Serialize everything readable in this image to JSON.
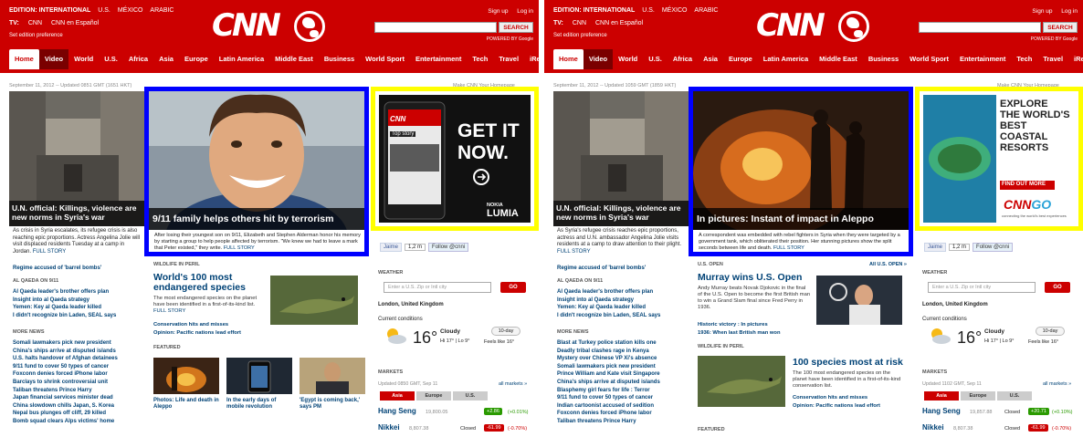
{
  "panels": [
    {
      "header": {
        "edition_label": "EDITION: INTERNATIONAL",
        "edition_links": [
          "U.S.",
          "MÉXICO",
          "ARABIC"
        ],
        "tv_label": "TV:",
        "tv_links": [
          "CNN",
          "CNN en Español"
        ],
        "set_pref": "Set edition preference",
        "logo": "CNN",
        "sign_up": "Sign up",
        "log_in": "Log in",
        "search_button": "SEARCH",
        "powered_by": "POWERED BY Google"
      },
      "nav": [
        "Home",
        "Video",
        "World",
        "U.S.",
        "Africa",
        "Asia",
        "Europe",
        "Latin America",
        "Middle East",
        "Business",
        "World Sport",
        "Entertainment",
        "Tech",
        "Travel",
        "iReport"
      ],
      "date_line": "September 11, 2012 -- Updated 0851 GMT (1651 HKT)",
      "make_cnn": "Make CNN Your Homepage",
      "lead": {
        "caption": "U.N. official: Killings, violence are new norms in Syria's war",
        "summary": "As crisis in Syria escalates, its refugee crisis is also reaching epic proportions. Actress Angelina Jolie will visit displaced residents Tuesday at a camp in Jordan.",
        "full_story": "FULL STORY"
      },
      "lead_bullets": [
        "Regime accused of 'barrel bombs'"
      ],
      "section1": "AL QAEDA ON 9/11",
      "section1_items": [
        "Al Qaeda leader's brother offers plan",
        "Insight into al Qaeda strategy",
        "Yemen: Key al Qaeda leader killed",
        "I didn't recognize bin Laden, SEAL says"
      ],
      "section2": "MORE NEWS",
      "section2_items": [
        "Somali lawmakers pick new president",
        "China's ships arrive at disputed islands",
        "U.S. halts handover of Afghan detainees",
        "9/11 fund to cover 50 types of cancer",
        "Foxconn denies forced iPhone labor",
        "Barclays to shrink controversial unit",
        "Taliban threatens Prince Harry",
        "Japan financial services minister dead",
        "China slowdown chills Japan, S. Korea",
        "Nepal bus plunges off cliff, 29 killed",
        "Bomb squad clears Alps victims' home"
      ],
      "feature": {
        "caption": "9/11 family helps others hit by terrorism",
        "summary": "After losing their youngest son on 9/11, Elizabeth and Stephen Alderman honor his memory by starting a group to help people affected by terrorism. \"We knew we had to leave a mark that Peter existed,\" they write.",
        "full_story": "FULL STORY"
      },
      "ad": {
        "headline1": "GET IT",
        "headline2": "NOW.",
        "brand1": "NOKIA",
        "brand2": "LUMIA",
        "phone_header": "CNN",
        "phone_story": "Top story"
      },
      "social": {
        "facebook": "Jaime",
        "count": "1,2 m",
        "twitter": "Follow @cnni"
      },
      "mid": {
        "section": "WILDLIFE IN PERIL",
        "headline": "World's 100 most endangered species",
        "summary": "The most endangered species on the planet have been identified in a first-of-its-kind list.",
        "full_story": "FULL STORY",
        "bullets": [
          "Conservation hits and misses",
          "Opinion: Pacific nations lead effort"
        ],
        "featured_label": "FEATURED",
        "featured": [
          "Photos: Life and death in Aleppo",
          "In the early days of mobile revolution",
          "'Egypt is coming back,' says PM"
        ]
      },
      "weather": {
        "section": "WEATHER",
        "placeholder": "Enter a U.S. Zip or Intl city",
        "go": "GO",
        "location": "London, United Kingdom",
        "current_label": "Current conditions",
        "temp": "16°",
        "condition": "Cloudy",
        "hilo": "Hi 17° | Lo 9°",
        "ten_day": "10-day",
        "feels": "Feels like 16°"
      },
      "markets": {
        "section": "MARKETS",
        "updated": "Updated 0850 GMT, Sep 11",
        "all_markets": "all markets »",
        "tabs": [
          "Asia",
          "Europe",
          "U.S."
        ],
        "rows": [
          {
            "name": "Hang Seng",
            "value": "19,800.05",
            "status": "",
            "change": "+2.86",
            "pct": "(+0.01%)",
            "up": true
          },
          {
            "name": "Nikkei",
            "value": "8,807.38",
            "status": "Closed",
            "change": "-61.99",
            "pct": "(-0.70%)",
            "up": false
          }
        ]
      }
    },
    {
      "header": {
        "edition_label": "EDITION: INTERNATIONAL",
        "edition_links": [
          "U.S.",
          "MÉXICO",
          "ARABIC"
        ],
        "tv_label": "TV:",
        "tv_links": [
          "CNN",
          "CNN en Español"
        ],
        "set_pref": "Set edition preference",
        "logo": "CNN",
        "sign_up": "Sign up",
        "log_in": "Log in",
        "search_button": "SEARCH",
        "powered_by": "POWERED BY Google"
      },
      "nav": [
        "Home",
        "Video",
        "World",
        "U.S.",
        "Africa",
        "Asia",
        "Europe",
        "Latin America",
        "Middle East",
        "Business",
        "World Sport",
        "Entertainment",
        "Tech",
        "Travel",
        "iReport"
      ],
      "date_line": "September 11, 2012 -- Updated 1059 GMT (1859 HKT)",
      "make_cnn": "Make CNN Your Homepage",
      "lead": {
        "caption": "U.N. official: Killings, violence are new norms in Syria's war",
        "summary": "As Syria's refugee crisis reaches epic proportions, actress and U.N. ambassador Angelina Jolie visits residents at a camp to draw attention to their plight.",
        "full_story": "FULL STORY"
      },
      "lead_bullets": [
        "Regime accused of 'barrel bombs'"
      ],
      "section1": "AL QAEDA ON 9/11",
      "section1_items": [
        "Al Qaeda leader's brother offers plan",
        "Insight into al Qaeda strategy",
        "Yemen: Key al Qaeda leader killed",
        "I didn't recognize bin Laden, SEAL says"
      ],
      "section2": "MORE NEWS",
      "section2_items": [
        "Blast at Turkey police station kills one",
        "Deadly tribal clashes rage in Kenya",
        "Mystery over Chinese VP Xi's absence",
        "Somali lawmakers pick new president",
        "Prince William and Kate visit Singapore",
        "China's ships arrive at disputed islands",
        "Blasphemy girl fears for life : Terror",
        "9/11 fund to cover 50 types of cancer",
        "Indian cartoonist accused of sedition",
        "Foxconn denies forced iPhone labor",
        "Taliban threatens Prince Harry"
      ],
      "feature": {
        "caption": "In pictures: Instant of impact in Aleppo",
        "summary": "A correspondent was embedded with rebel fighters in Syria when they were targeted by a government tank, which obliterated their position. Her stunning pictures show the split seconds between life and death.",
        "full_story": "FULL STORY"
      },
      "ad": {
        "headline1": "EXPLORE",
        "headline2": "THE WORLD'S BEST COASTAL RESORTS",
        "find_out": "FIND OUT MORE",
        "brand1": "CNN",
        "brand2": "GO",
        "tagline": "connecting the world's best experiences"
      },
      "social": {
        "facebook": "Jaime",
        "count": "1,2 m",
        "twitter": "Follow @cnni"
      },
      "mid": {
        "section": "U.S. OPEN",
        "section_link": "All U.S. OPEN »",
        "headline": "Murray wins U.S. Open",
        "summary": "Andy Murray beats Novak Djokovic in the final of the U.S. Open to become the first British man to win a Grand Slam final since Fred Perry in 1936.",
        "full_story": "FULL STORY",
        "bullets": [
          "Historic victory : In pictures",
          "1936: When last British man won"
        ],
        "section2": "WILDLIFE IN PERIL",
        "headline2": "100 species most at risk",
        "summary2": "The 100 most endangered species on the planet have been identified in a first-of-its-kind conservation list.",
        "bullets2": [
          "Conservation hits and misses",
          "Opinion: Pacific nations lead effort"
        ],
        "featured_label": "FEATURED"
      },
      "weather": {
        "section": "WEATHER",
        "placeholder": "Enter a U.S. Zip or Intl city",
        "go": "GO",
        "location": "London, United Kingdom",
        "current_label": "Current conditions",
        "temp": "16°",
        "condition": "Cloudy",
        "hilo": "Hi 17° | Lo 9°",
        "ten_day": "10-day",
        "feels": "Feels like 16°"
      },
      "markets": {
        "section": "MARKETS",
        "updated": "Updated 1102 GMT, Sep 11",
        "all_markets": "all markets »",
        "tabs": [
          "Asia",
          "Europe",
          "U.S."
        ],
        "rows": [
          {
            "name": "Hang Seng",
            "value": "19,857.88",
            "status": "Closed",
            "change": "+20.71",
            "pct": "(+0.10%)",
            "up": true
          },
          {
            "name": "Nikkei",
            "value": "8,807.38",
            "status": "Closed",
            "change": "-61.99",
            "pct": "(-0.70%)",
            "up": false
          }
        ]
      }
    }
  ],
  "colors": {
    "cnn_red": "#cc0000",
    "link_blue": "#004276",
    "highlight_blue": "#0000ff",
    "highlight_yellow": "#ffff00",
    "up_green": "#2a9a00"
  }
}
